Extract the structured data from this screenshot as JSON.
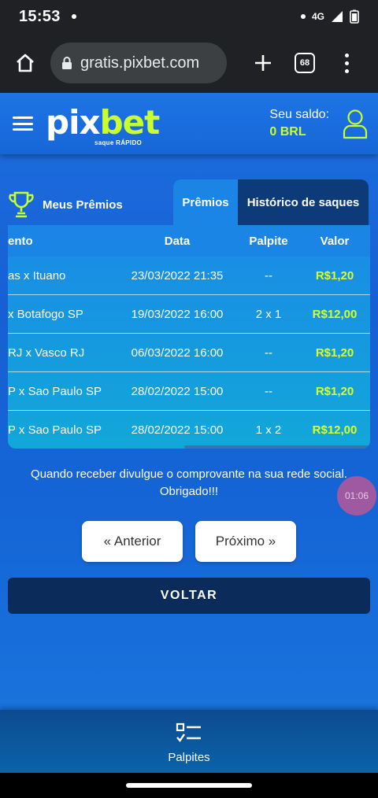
{
  "status_bar": {
    "time": "15:53",
    "network": "4G"
  },
  "browser": {
    "url": "gratis.pixbet.com",
    "tab_count": "68"
  },
  "header": {
    "logo_part1": "pix",
    "logo_part2": "bet",
    "logo_tagline": "saque RÁPIDO",
    "balance_label": "Seu saldo:",
    "balance_value": "0 BRL"
  },
  "tabs": {
    "my_prizes": "Meus Prêmios",
    "premios": "Prêmios",
    "historico": "Histórico de saques"
  },
  "table": {
    "headers": [
      "ento",
      "Data",
      "Palpite",
      "Valor"
    ],
    "rows": [
      {
        "event": "as x Ituano",
        "date": "23/03/2022 21:35",
        "guess": "--",
        "value": "R$1,20"
      },
      {
        "event": " x Botafogo SP",
        "date": "19/03/2022 16:00",
        "guess": "2 x 1",
        "value": "R$12,00"
      },
      {
        "event": "RJ x Vasco RJ",
        "date": "06/03/2022 16:00",
        "guess": "--",
        "value": "R$1,20"
      },
      {
        "event": "P x Sao Paulo SP",
        "date": "28/02/2022 15:00",
        "guess": "--",
        "value": "R$1,20"
      },
      {
        "event": "P x Sao Paulo SP",
        "date": "28/02/2022 15:00",
        "guess": "1 x 2",
        "value": "R$12,00"
      }
    ]
  },
  "timer": "01:06",
  "notice": "Quando receber divulgue o comprovante na sua rede social. Obrigado!!!",
  "pager": {
    "previous": "« Anterior",
    "next": "Próximo »"
  },
  "back_button": "VOLTAR",
  "bottom_nav": {
    "label": "Palpites"
  },
  "colors": {
    "accent": "#c8ff2e",
    "primary": "#1766d8",
    "dark": "#0b2c5a"
  }
}
